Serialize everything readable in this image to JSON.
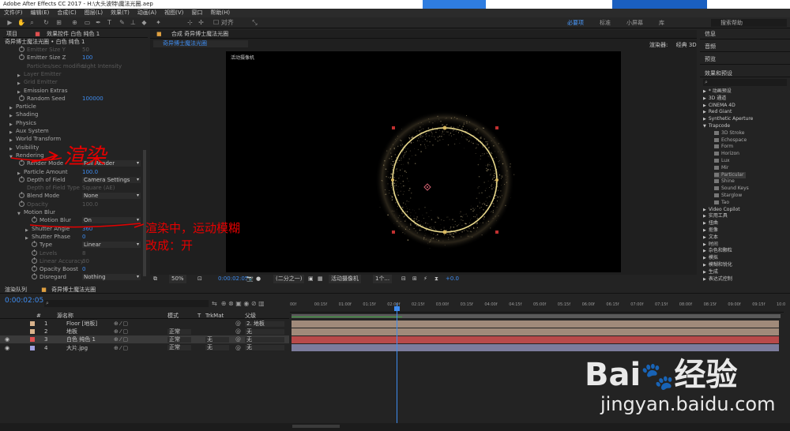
{
  "window": {
    "title": "Adobe After Effects CC 2017 - H:\\大头波特\\魔法光圈.aep"
  },
  "menu": [
    "文件(F)",
    "编辑(E)",
    "合成(C)",
    "图层(L)",
    "效果(T)",
    "动画(A)",
    "视图(V)",
    "窗口",
    "帮助(H)"
  ],
  "toolbar": {
    "snap_label": "对齐",
    "workspaces": [
      "必要项",
      "标准",
      "小屏幕",
      "库"
    ],
    "active_workspace": "必要项",
    "search_placeholder": "搜索帮助"
  },
  "effect_controls": {
    "tabs": [
      "项目",
      "效果控件 白色 纯色 1"
    ],
    "breadcrumb": "奇异博士魔法光圈 • 白色 纯色 1",
    "rows": [
      {
        "name": "Emitter Size Y",
        "value": "50",
        "indent": 30,
        "dim": true,
        "stopwatch": true
      },
      {
        "name": "Emitter Size Z",
        "value": "100",
        "indent": 30,
        "stopwatch": true
      },
      {
        "name": "Particles/sec modifier",
        "value": "Light Intensity",
        "indent": 30,
        "dim": true
      },
      {
        "name": "Layer Emitter",
        "indent": 26,
        "tri": true,
        "dim": true
      },
      {
        "name": "Grid Emitter",
        "indent": 26,
        "tri": true,
        "dim": true
      },
      {
        "name": "Emission Extras",
        "indent": 26,
        "tri": true
      },
      {
        "name": "Random Seed",
        "value": "100000",
        "indent": 30,
        "stopwatch": true
      },
      {
        "name": "Particle",
        "indent": 16,
        "tri": true
      },
      {
        "name": "Shading",
        "indent": 16,
        "tri": true
      },
      {
        "name": "Physics",
        "indent": 16,
        "tri": true
      },
      {
        "name": "Aux System",
        "indent": 16,
        "tri": true
      },
      {
        "name": "World Transform",
        "indent": 16,
        "tri": true
      },
      {
        "name": "Visibility",
        "indent": 16,
        "tri": true
      },
      {
        "name": "Rendering",
        "indent": 16,
        "tri": true,
        "open": true
      },
      {
        "name": "Render Mode",
        "drop": "Full Render",
        "indent": 30,
        "stopwatch": true
      },
      {
        "name": "Particle Amount",
        "value": "100.0",
        "indent": 26,
        "tri": true
      },
      {
        "name": "Depth of Field",
        "drop": "Camera Settings",
        "indent": 30,
        "stopwatch": true
      },
      {
        "name": "Depth of Field Type",
        "value": "Square (AE)",
        "indent": 30,
        "dim": true
      },
      {
        "name": "Blend Mode",
        "drop": "None",
        "indent": 30,
        "stopwatch": true
      },
      {
        "name": "Opacity",
        "value": "100.0",
        "indent": 30,
        "dim": true,
        "stopwatch": true
      },
      {
        "name": "Motion Blur",
        "indent": 26,
        "tri": true,
        "open": true
      },
      {
        "name": "Motion Blur",
        "drop": "On",
        "indent": 46,
        "stopwatch": true
      },
      {
        "name": "Shutter Angle",
        "value": "360",
        "indent": 36,
        "tri": true
      },
      {
        "name": "Shutter Phase",
        "value": "0",
        "indent": 36,
        "tri": true
      },
      {
        "name": "Type",
        "drop": "Linear",
        "indent": 46,
        "stopwatch": true
      },
      {
        "name": "Levels",
        "value": "8",
        "indent": 46,
        "dim": true,
        "stopwatch": true
      },
      {
        "name": "Linear Accuracy",
        "value": "30",
        "indent": 46,
        "dim": true,
        "stopwatch": true
      },
      {
        "name": "Opacity Boost",
        "value": "0",
        "indent": 46,
        "stopwatch": true
      },
      {
        "name": "Disregard",
        "drop": "Nothing",
        "indent": 46,
        "stopwatch": true
      }
    ]
  },
  "composition": {
    "tab": "合成 奇异博士魔法光圈",
    "subtab": "奇异博士魔法光圈",
    "renderer_label": "渲染器:",
    "renderer": "经典 3D",
    "camera_label": "活动摄像机",
    "bottom": {
      "zoom": "50%",
      "time": "0:00:02:05",
      "resolution": "(二分之一)",
      "view": "活动摄像机",
      "views": "1个...",
      "exposure": "+0.0"
    }
  },
  "right_panel": {
    "sections": [
      "信息",
      "音频",
      "预览"
    ],
    "effects_title": "效果和预设",
    "items": [
      {
        "label": "* 动画预设",
        "sub": false
      },
      {
        "label": "3D 通道",
        "sub": false
      },
      {
        "label": "CINEMA 4D",
        "sub": false
      },
      {
        "label": "Red Giant",
        "sub": false
      },
      {
        "label": "Synthetic Aperture",
        "sub": false
      },
      {
        "label": "Trapcode",
        "sub": false,
        "open": true
      },
      {
        "label": "3D Stroke",
        "sub": true
      },
      {
        "label": "Echospace",
        "sub": true
      },
      {
        "label": "Form",
        "sub": true
      },
      {
        "label": "Horizon",
        "sub": true
      },
      {
        "label": "Lux",
        "sub": true
      },
      {
        "label": "Mir",
        "sub": true
      },
      {
        "label": "Particular",
        "sub": true,
        "sel": true
      },
      {
        "label": "Shine",
        "sub": true
      },
      {
        "label": "Sound Keys",
        "sub": true
      },
      {
        "label": "Starglow",
        "sub": true
      },
      {
        "label": "Tao",
        "sub": true
      },
      {
        "label": "Video Copilot",
        "sub": false
      },
      {
        "label": "实用工具",
        "sub": false
      },
      {
        "label": "扭曲",
        "sub": false
      },
      {
        "label": "抠像",
        "sub": false
      },
      {
        "label": "文本",
        "sub": false
      },
      {
        "label": "时间",
        "sub": false
      },
      {
        "label": "杂色和颗粒",
        "sub": false
      },
      {
        "label": "模拟",
        "sub": false
      },
      {
        "label": "模糊和锐化",
        "sub": false
      },
      {
        "label": "生成",
        "sub": false
      },
      {
        "label": "表达式控制",
        "sub": false
      }
    ]
  },
  "timeline": {
    "tabs": [
      "渲染队列",
      "奇异博士魔法光圈"
    ],
    "timecode": "0:00:02:05",
    "headers": {
      "num": "#",
      "source": "源名称",
      "mode": "模式",
      "t": "T",
      "trkmat": "TrkMat",
      "parent": "父级"
    },
    "layers": [
      {
        "num": "1",
        "name": "Floor [地板]",
        "color": "#d9b38c",
        "mode": "",
        "trk": "",
        "parent": "2. 地板",
        "barcolor": "#a08a7a"
      },
      {
        "num": "2",
        "name": "地板",
        "color": "#d9b38c",
        "mode": "正常",
        "trk": "",
        "parent": "无",
        "barcolor": "#a08a7a"
      },
      {
        "num": "3",
        "name": "白色 纯色 1",
        "color": "#e05050",
        "mode": "正常",
        "trk": "无",
        "parent": "无",
        "barcolor": "#b84a4a",
        "sel": true
      },
      {
        "num": "4",
        "name": "大片.jpg",
        "color": "#a0a0e0",
        "mode": "正常",
        "trk": "无",
        "parent": "无",
        "barcolor": "#7c7c9c"
      }
    ],
    "ticks": [
      "00f",
      "00:15f",
      "01:00f",
      "01:15f",
      "02:00f",
      "02:15f",
      "03:00f",
      "03:15f",
      "04:00f",
      "04:15f",
      "05:00f",
      "05:15f",
      "06:00f",
      "06:15f",
      "07:00f",
      "07:15f",
      "08:00f",
      "08:15f",
      "09:00f",
      "09:15f",
      "10:0"
    ]
  },
  "annotations": {
    "rendering": "渲染",
    "motion_blur_note": "渲染中，运动模糊",
    "motion_blur_note2": "改成：开"
  },
  "watermark": {
    "brand_a": "Bai",
    "brand_b": "经验",
    "url": "jingyan.baidu.com"
  }
}
